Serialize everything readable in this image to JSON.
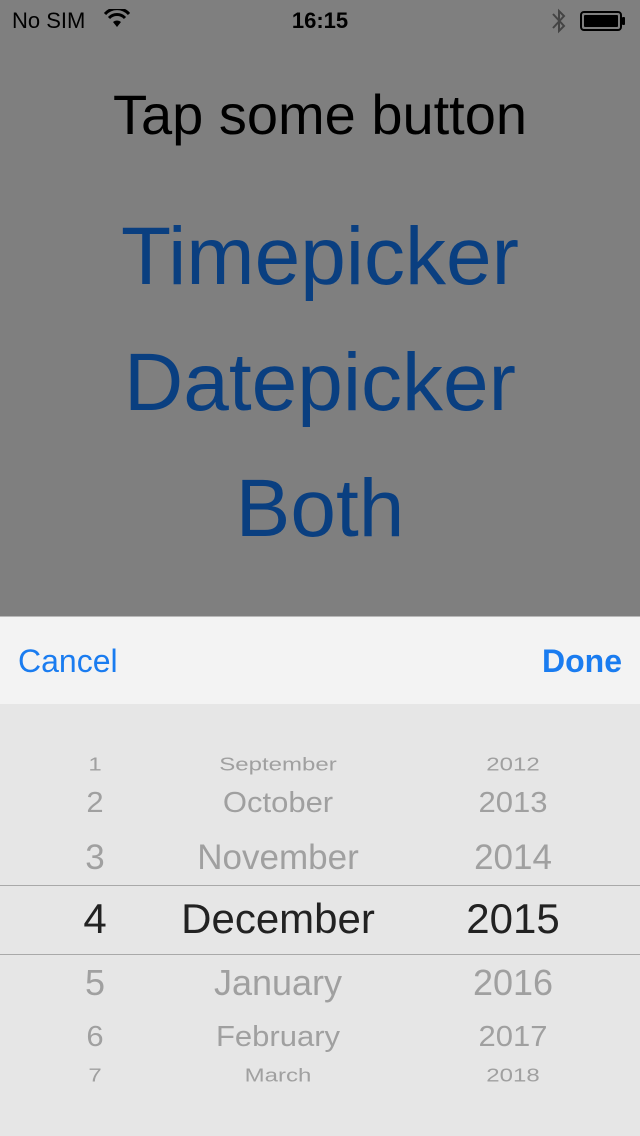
{
  "status": {
    "carrier": "No SIM",
    "time": "16:15",
    "wifi_icon": "wifi-icon",
    "bluetooth_icon": "bluetooth-icon",
    "battery_icon": "battery-icon"
  },
  "prompt": "Tap some button",
  "buttons": {
    "timepicker": "Timepicker",
    "datepicker": "Datepicker",
    "both": "Both"
  },
  "toolbar": {
    "cancel": "Cancel",
    "done": "Done"
  },
  "picker": {
    "days": [
      "1",
      "2",
      "3",
      "4",
      "5",
      "6",
      "7"
    ],
    "months": [
      "September",
      "October",
      "November",
      "December",
      "January",
      "February",
      "March"
    ],
    "years": [
      "2012",
      "2013",
      "2014",
      "2015",
      "2016",
      "2017",
      "2018"
    ],
    "selected": {
      "day": "4",
      "month": "December",
      "year": "2015"
    }
  },
  "colors": {
    "button_text": "#0a3f80",
    "toolbar_accent": "#1a7cf0",
    "dim_background": "#7f7f7f"
  }
}
